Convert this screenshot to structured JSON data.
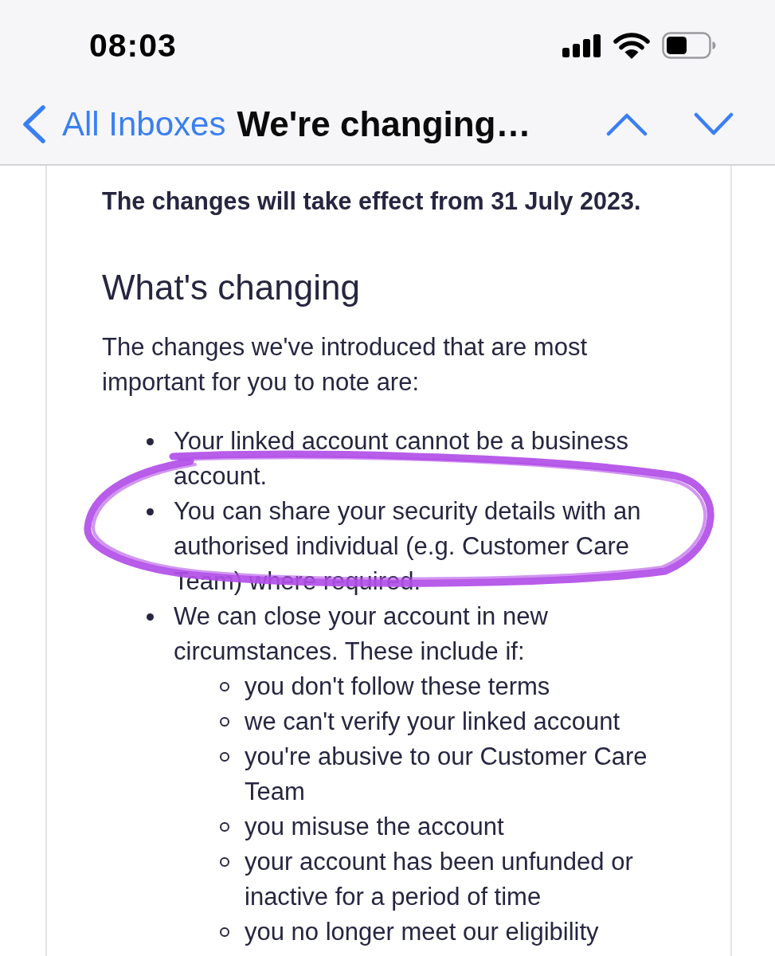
{
  "status_bar": {
    "time": "08:03"
  },
  "nav_bar": {
    "back_label": "All Inboxes",
    "title": "We're changing…"
  },
  "email": {
    "notice": "The changes will take effect from 31 July 2023.",
    "heading": "What's changing",
    "intro": "The changes we've introduced that are most important for you to note are:",
    "bullets": [
      {
        "text": "Your linked account cannot be a business account.",
        "circled": false
      },
      {
        "text": "You can share your security details with an authorised individual (e.g. Customer Care Team) where required.",
        "circled": true
      },
      {
        "text": "We can close your account in new circumstances. These include if:",
        "circled": false,
        "children": [
          {
            "text": "you don't follow these terms",
            "circled": false
          },
          {
            "text": "we can't verify your linked account",
            "circled": false
          },
          {
            "text": "you're abusive to our Customer Care Team",
            "circled": false
          },
          {
            "text": "you misuse the account",
            "circled": false
          },
          {
            "text": "your account has been unfunded or inactive for a period of time",
            "circled": false
          },
          {
            "text": "you no longer meet our eligibility",
            "circled": false
          }
        ]
      }
    ]
  }
}
